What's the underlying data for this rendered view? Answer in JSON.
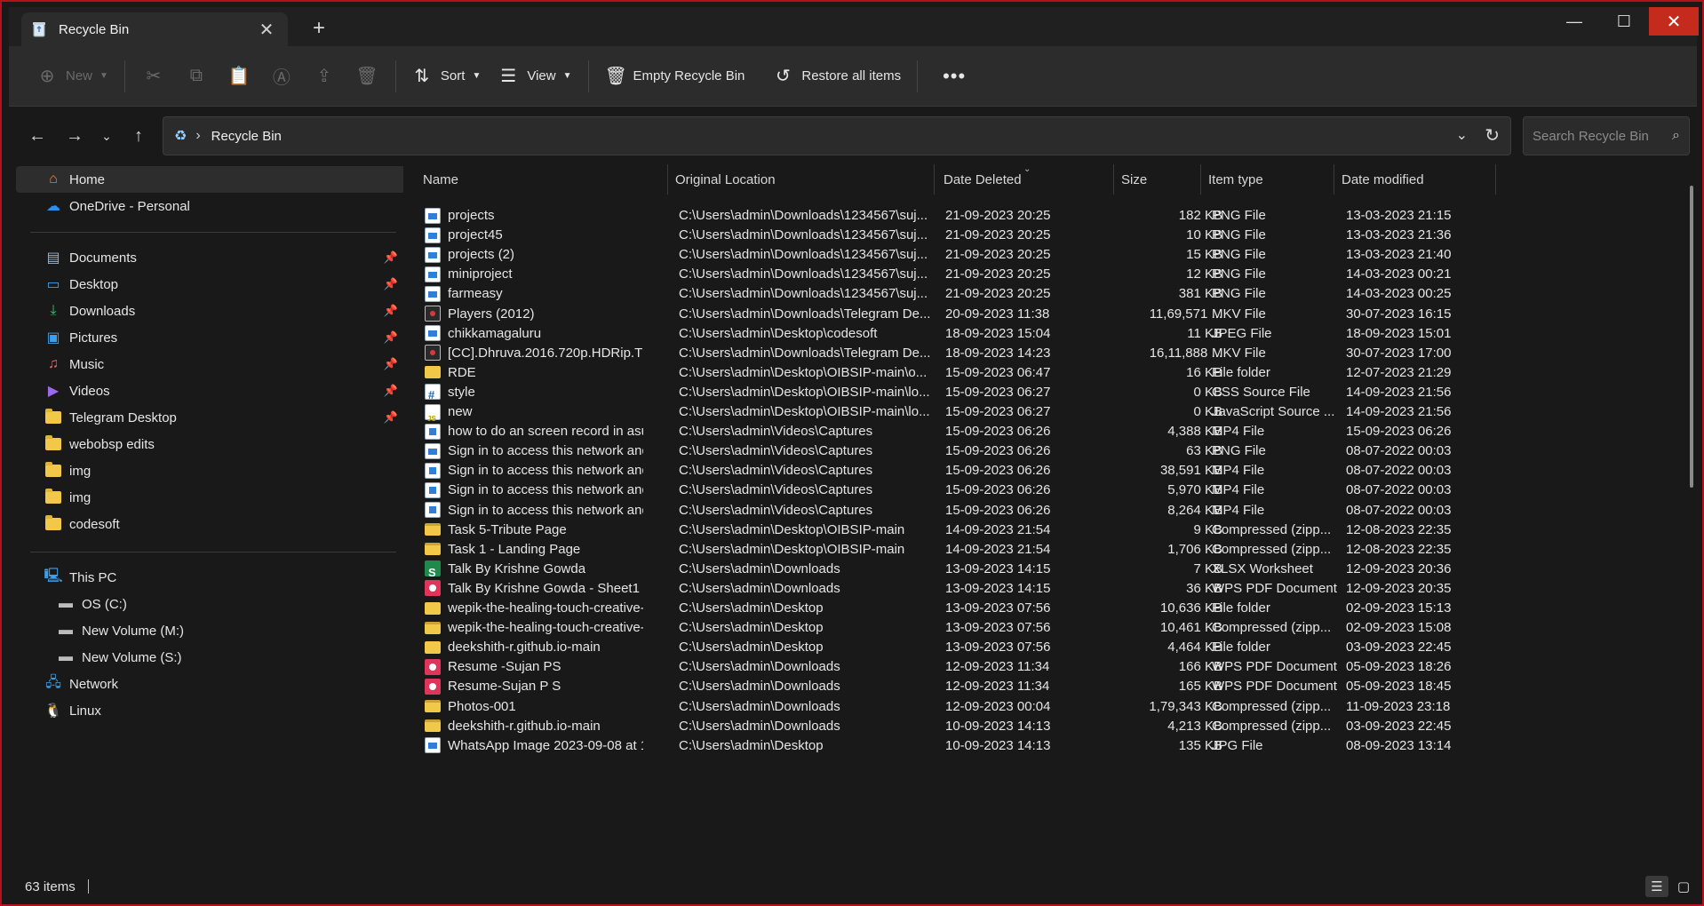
{
  "window": {
    "tab_title": "Recycle Bin",
    "tab_close": "✕",
    "new_tab": "+",
    "minimize": "—",
    "maximize": "☐",
    "close": "✕"
  },
  "toolbar": {
    "new_label": "New",
    "sort_label": "Sort",
    "view_label": "View",
    "empty_label": "Empty Recycle Bin",
    "restore_label": "Restore all items",
    "more": "•••"
  },
  "address": {
    "crumb": "Recycle Bin",
    "search_placeholder": "Search Recycle Bin"
  },
  "sidebar": {
    "home": "Home",
    "onedrive": "OneDrive - Personal",
    "pinned": [
      "Documents",
      "Desktop",
      "Downloads",
      "Pictures",
      "Music",
      "Videos",
      "Telegram Desktop"
    ],
    "folders": [
      "webobsp edits",
      "img",
      "img",
      "codesoft"
    ],
    "thispc": "This PC",
    "drives": [
      "OS (C:)",
      "New Volume (M:)",
      "New Volume (S:)"
    ],
    "network": "Network",
    "linux": "Linux"
  },
  "columns": {
    "name": "Name",
    "location": "Original Location",
    "date_deleted": "Date Deleted",
    "size": "Size",
    "type": "Item type",
    "modified": "Date modified"
  },
  "files": [
    {
      "icon": "png",
      "name": "projects",
      "loc": "C:\\Users\\admin\\Downloads\\1234567\\suj...",
      "deleted": "21-09-2023 20:25",
      "size": "182 KB",
      "type": "PNG File",
      "modified": "13-03-2023 21:15"
    },
    {
      "icon": "png",
      "name": "project45",
      "loc": "C:\\Users\\admin\\Downloads\\1234567\\suj...",
      "deleted": "21-09-2023 20:25",
      "size": "10 KB",
      "type": "PNG File",
      "modified": "13-03-2023 21:36"
    },
    {
      "icon": "png",
      "name": "projects (2)",
      "loc": "C:\\Users\\admin\\Downloads\\1234567\\suj...",
      "deleted": "21-09-2023 20:25",
      "size": "15 KB",
      "type": "PNG File",
      "modified": "13-03-2023 21:40"
    },
    {
      "icon": "png",
      "name": "miniproject",
      "loc": "C:\\Users\\admin\\Downloads\\1234567\\suj...",
      "deleted": "21-09-2023 20:25",
      "size": "12 KB",
      "type": "PNG File",
      "modified": "14-03-2023 00:21"
    },
    {
      "icon": "png",
      "name": "farmeasy",
      "loc": "C:\\Users\\admin\\Downloads\\1234567\\suj...",
      "deleted": "21-09-2023 20:25",
      "size": "381 KB",
      "type": "PNG File",
      "modified": "14-03-2023 00:25"
    },
    {
      "icon": "mkv",
      "name": "Players (2012)",
      "loc": "C:\\Users\\admin\\Downloads\\Telegram De...",
      "deleted": "20-09-2023 11:38",
      "size": "11,69,571 ...",
      "type": "MKV File",
      "modified": "30-07-2023 16:15"
    },
    {
      "icon": "jpg",
      "name": "chikkamagaluru",
      "loc": "C:\\Users\\admin\\Desktop\\codesoft",
      "deleted": "18-09-2023 15:04",
      "size": "11 KB",
      "type": "JPEG File",
      "modified": "18-09-2023 15:01"
    },
    {
      "icon": "mkv",
      "name": "[CC].Dhruva.2016.720p.HDRip.TELU...",
      "loc": "C:\\Users\\admin\\Downloads\\Telegram De...",
      "deleted": "18-09-2023 14:23",
      "size": "16,11,888 ...",
      "type": "MKV File",
      "modified": "30-07-2023 17:00"
    },
    {
      "icon": "folder",
      "name": "RDE",
      "loc": "C:\\Users\\admin\\Desktop\\OIBSIP-main\\o...",
      "deleted": "15-09-2023 06:47",
      "size": "16 KB",
      "type": "File folder",
      "modified": "12-07-2023 21:29"
    },
    {
      "icon": "css",
      "name": "style",
      "loc": "C:\\Users\\admin\\Desktop\\OIBSIP-main\\lo...",
      "deleted": "15-09-2023 06:27",
      "size": "0 KB",
      "type": "CSS Source File",
      "modified": "14-09-2023 21:56"
    },
    {
      "icon": "js",
      "name": "new",
      "loc": "C:\\Users\\admin\\Desktop\\OIBSIP-main\\lo...",
      "deleted": "15-09-2023 06:27",
      "size": "0 KB",
      "type": "JavaScript Source ...",
      "modified": "14-09-2023 21:56"
    },
    {
      "icon": "mp4",
      "name": "how to do an screen record in asus ...",
      "loc": "C:\\Users\\admin\\Videos\\Captures",
      "deleted": "15-09-2023 06:26",
      "size": "4,388 KB",
      "type": "MP4 File",
      "modified": "15-09-2023 06:26"
    },
    {
      "icon": "png",
      "name": "Sign in to access this network and ...",
      "loc": "C:\\Users\\admin\\Videos\\Captures",
      "deleted": "15-09-2023 06:26",
      "size": "63 KB",
      "type": "PNG File",
      "modified": "08-07-2022 00:03"
    },
    {
      "icon": "mp4",
      "name": "Sign in to access this network and ...",
      "loc": "C:\\Users\\admin\\Videos\\Captures",
      "deleted": "15-09-2023 06:26",
      "size": "38,591 KB",
      "type": "MP4 File",
      "modified": "08-07-2022 00:03"
    },
    {
      "icon": "mp4",
      "name": "Sign in to access this network and ...",
      "loc": "C:\\Users\\admin\\Videos\\Captures",
      "deleted": "15-09-2023 06:26",
      "size": "5,970 KB",
      "type": "MP4 File",
      "modified": "08-07-2022 00:03"
    },
    {
      "icon": "mp4",
      "name": "Sign in to access this network and ...",
      "loc": "C:\\Users\\admin\\Videos\\Captures",
      "deleted": "15-09-2023 06:26",
      "size": "8,264 KB",
      "type": "MP4 File",
      "modified": "08-07-2022 00:03"
    },
    {
      "icon": "zip",
      "name": "Task 5-Tribute Page",
      "loc": "C:\\Users\\admin\\Desktop\\OIBSIP-main",
      "deleted": "14-09-2023 21:54",
      "size": "9 KB",
      "type": "Compressed (zipp...",
      "modified": "12-08-2023 22:35"
    },
    {
      "icon": "zip",
      "name": "Task 1 - Landing Page",
      "loc": "C:\\Users\\admin\\Desktop\\OIBSIP-main",
      "deleted": "14-09-2023 21:54",
      "size": "1,706 KB",
      "type": "Compressed (zipp...",
      "modified": "12-08-2023 22:35"
    },
    {
      "icon": "xlsx",
      "name": "Talk By Krishne Gowda",
      "loc": "C:\\Users\\admin\\Downloads",
      "deleted": "13-09-2023 14:15",
      "size": "7 KB",
      "type": "XLSX Worksheet",
      "modified": "12-09-2023 20:36"
    },
    {
      "icon": "pdf",
      "name": "Talk By Krishne Gowda  - Sheet1",
      "loc": "C:\\Users\\admin\\Downloads",
      "deleted": "13-09-2023 14:15",
      "size": "36 KB",
      "type": "WPS PDF Document",
      "modified": "12-09-2023 20:35"
    },
    {
      "icon": "folder",
      "name": "wepik-the-healing-touch-creative-...",
      "loc": "C:\\Users\\admin\\Desktop",
      "deleted": "13-09-2023 07:56",
      "size": "10,636 KB",
      "type": "File folder",
      "modified": "02-09-2023 15:13"
    },
    {
      "icon": "zip",
      "name": "wepik-the-healing-touch-creative-...",
      "loc": "C:\\Users\\admin\\Desktop",
      "deleted": "13-09-2023 07:56",
      "size": "10,461 KB",
      "type": "Compressed (zipp...",
      "modified": "02-09-2023 15:08"
    },
    {
      "icon": "folder",
      "name": "deekshith-r.github.io-main",
      "loc": "C:\\Users\\admin\\Desktop",
      "deleted": "13-09-2023 07:56",
      "size": "4,464 KB",
      "type": "File folder",
      "modified": "03-09-2023 22:45"
    },
    {
      "icon": "pdf",
      "name": "Resume -Sujan PS",
      "loc": "C:\\Users\\admin\\Downloads",
      "deleted": "12-09-2023 11:34",
      "size": "166 KB",
      "type": "WPS PDF Document",
      "modified": "05-09-2023 18:26"
    },
    {
      "icon": "pdf",
      "name": "Resume-Sujan P   S",
      "loc": "C:\\Users\\admin\\Downloads",
      "deleted": "12-09-2023 11:34",
      "size": "165 KB",
      "type": "WPS PDF Document",
      "modified": "05-09-2023 18:45"
    },
    {
      "icon": "zip",
      "name": "Photos-001",
      "loc": "C:\\Users\\admin\\Downloads",
      "deleted": "12-09-2023 00:04",
      "size": "1,79,343 KB",
      "type": "Compressed (zipp...",
      "modified": "11-09-2023 23:18"
    },
    {
      "icon": "zip",
      "name": "deekshith-r.github.io-main",
      "loc": "C:\\Users\\admin\\Downloads",
      "deleted": "10-09-2023 14:13",
      "size": "4,213 KB",
      "type": "Compressed (zipp...",
      "modified": "03-09-2023 22:45"
    },
    {
      "icon": "jpg",
      "name": "WhatsApp Image 2023-09-08 at 13...",
      "loc": "C:\\Users\\admin\\Desktop",
      "deleted": "10-09-2023 14:13",
      "size": "135 KB",
      "type": "JPG File",
      "modified": "08-09-2023 13:14"
    }
  ],
  "status": {
    "count": "63 items"
  }
}
